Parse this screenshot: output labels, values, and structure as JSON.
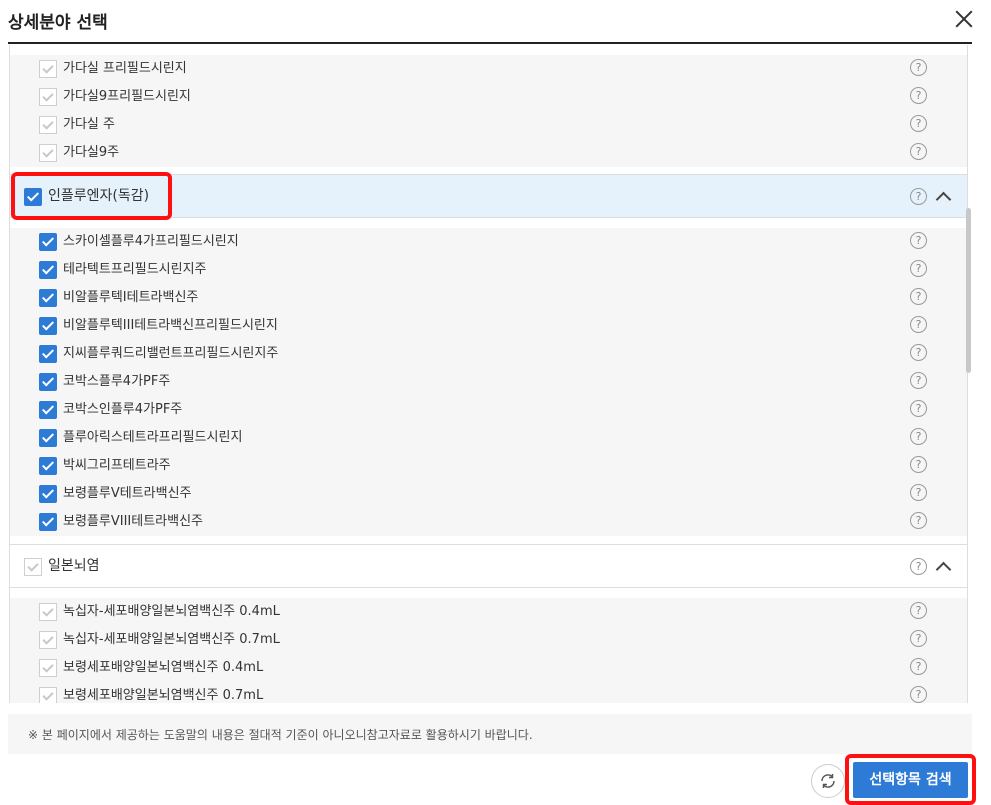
{
  "dialog": {
    "title": "상세분야 선택",
    "close_icon": "close-icon"
  },
  "top_items": [
    {
      "label": "가다실 프리필드시린지",
      "checked": true,
      "disabled": true
    },
    {
      "label": "가다실9프리필드시린지",
      "checked": true,
      "disabled": true
    },
    {
      "label": "가다실 주",
      "checked": true,
      "disabled": true
    },
    {
      "label": "가다실9주",
      "checked": true,
      "disabled": true
    }
  ],
  "groups": [
    {
      "label": "인플루엔자(독감)",
      "checked": true,
      "expanded": true,
      "highlighted": true,
      "items": [
        {
          "label": "스카이셀플루4가프리필드시린지",
          "checked": true
        },
        {
          "label": "테라텍트프리필드시린지주",
          "checked": true
        },
        {
          "label": "비알플루텍I테트라백신주",
          "checked": true
        },
        {
          "label": "비알플루텍III테트라백신프리필드시린지",
          "checked": true
        },
        {
          "label": "지씨플루쿼드리밸런트프리필드시린지주",
          "checked": true
        },
        {
          "label": "코박스플루4가PF주",
          "checked": true
        },
        {
          "label": "코박스인플루4가PF주",
          "checked": true
        },
        {
          "label": "플루아릭스테트라프리필드시린지",
          "checked": true
        },
        {
          "label": "박씨그리프테트라주",
          "checked": true
        },
        {
          "label": "보령플루Ⅴ테트라백신주",
          "checked": true
        },
        {
          "label": "보령플루VIII테트라백신주",
          "checked": true
        }
      ]
    },
    {
      "label": "일본뇌염",
      "checked": false,
      "expanded": true,
      "highlighted": false,
      "items": [
        {
          "label": "녹십자-세포배양일본뇌염백신주 0.4mL",
          "checked": true,
          "disabled": true
        },
        {
          "label": "녹십자-세포배양일본뇌염백신주 0.7mL",
          "checked": true,
          "disabled": true
        },
        {
          "label": "보령세포배양일본뇌염백신주 0.4mL",
          "checked": true,
          "disabled": true
        },
        {
          "label": "보령세포배양일본뇌염백신주 0.7mL",
          "checked": true,
          "disabled": true
        }
      ]
    }
  ],
  "help_glyph": "?",
  "notice": "※ 본 페이지에서 제공하는 도움말의 내용은 절대적 기준이 아니오니참고자료로 활용하시기 바랍니다.",
  "footer": {
    "refresh_icon": "refresh-icon",
    "search_button": "선택항목 검색",
    "search_highlighted": true
  },
  "colors": {
    "accent": "#2d7bd6",
    "highlight": "#ff1010",
    "active_group_bg": "#e5f2fb"
  }
}
